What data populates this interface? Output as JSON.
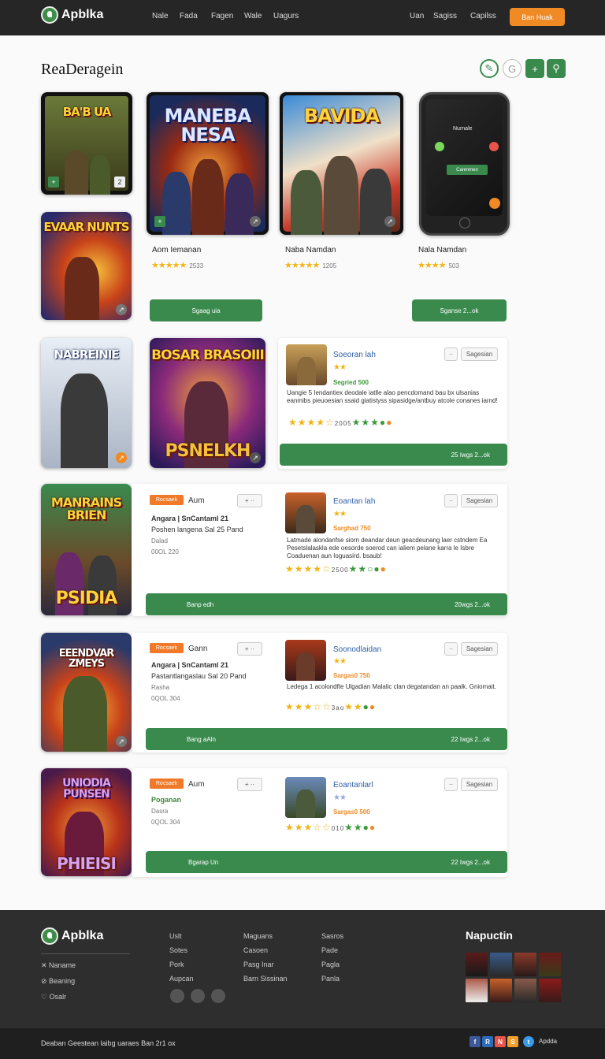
{
  "header": {
    "app_name": "Apblka",
    "nav_left": [
      "Nale",
      "Fada",
      "Fagen",
      "Wale",
      "Uagurs"
    ],
    "nav_right": [
      "Uan",
      "Sagiss",
      "Capilss"
    ],
    "cta_label": "Ban Huak"
  },
  "page": {
    "title": "ReaDeragein",
    "toolbar_icons": [
      "pencil-icon",
      "g-icon",
      "plus-icon",
      "search-icon"
    ]
  },
  "games_top": [
    {
      "title": "BA'B UA",
      "name": "",
      "rating": "",
      "count": ""
    },
    {
      "title": "MANEBA NESA",
      "name": "Aom Iemanan",
      "rating": "★★★★★",
      "count": "2533"
    },
    {
      "title": "BAVIDA",
      "name": "Naba Namdan",
      "rating": "★★★★★",
      "count": "1205"
    },
    {
      "title": "",
      "name": "Nala Namdan",
      "rating": "★★★★",
      "count": "503"
    }
  ],
  "phone": {
    "title": "Nurnale",
    "button": "Canmmen"
  },
  "top_buttons": {
    "left": "Sgaag uia",
    "right": "Sganse 2...ok"
  },
  "side_games": [
    {
      "title": "EVAAR NUNTS"
    },
    {
      "title": "NABREINIE"
    },
    {
      "title": "BOSAR BRASOIII",
      "subtitle": "PSNELKH"
    },
    {
      "title": "MANRAINS BRIEN",
      "subtitle": "PSIDIA"
    },
    {
      "title": "EEENDVAR ZMEYS"
    },
    {
      "title": "UNIODIA PUNSEN",
      "subtitle": "PHIEISI"
    }
  ],
  "listings": [
    {
      "tag": "",
      "name": "",
      "info": [],
      "review": {
        "user": "Soeoran lah",
        "tag": "Segried 500",
        "text": "Uangie 5 Iendantiex deodale iatlle alao pencdomand bau bx ulsanias eanmibs pieuoesian ssaid giatistyss sipasidge/antbuy atcole conanes iarnd!",
        "stars": "2005",
        "btn_small": "··",
        "btn_follow": "Sagesian"
      },
      "bottom_left": "",
      "bottom_right": "25 Iwgs 2...ok"
    },
    {
      "tag": "Rocsaek",
      "name": "Aum",
      "info": [
        "Angara | SnCantaml 21",
        "Poshen langena Sal 25 Pand",
        "Dalad",
        "00OL 220"
      ],
      "review": {
        "user": "Eoantan lah",
        "tag": "Sarghad 750",
        "text": "Latmade alondanfse siorn deandar deun geacdeunang laer cstndem Ea Pesetslalaskla ede oesorde soerod can ialiem pelane karra le Isbre Coaduenan aun Ioguasird. bsaub!",
        "stars": "2500",
        "btn_small": "··",
        "btn_follow": "Sagesian"
      },
      "bottom_left": "Banp edh",
      "bottom_right": "20wgs 2...ok"
    },
    {
      "tag": "Rocsaek",
      "name": "Gann",
      "info": [
        "Angara | SnCantaml 21",
        "Pastantlangaslau Sal 20 Pand",
        "Rasha",
        "0QOL 304"
      ],
      "review": {
        "user": "Soonodlaidan",
        "tag": "Sargas0 750",
        "text": "Ledega 1 acolondfte Ulgadian Malalic clan degatandan an paalk. Gniomait.",
        "stars": "3ao",
        "btn_small": "··",
        "btn_follow": "Sagesian"
      },
      "bottom_left": "Bang aAln",
      "bottom_right": "22 Iwgs 2...ok"
    },
    {
      "tag": "Rocsaek",
      "name": "Aum",
      "info": [
        "Poganan",
        "Dasra",
        "0QOL 304"
      ],
      "review": {
        "user": "Eoantanlarl",
        "tag": "Sargas0 500",
        "text": "",
        "stars": "010",
        "btn_small": "··",
        "btn_follow": "Sagesian"
      },
      "bottom_left": "Bgarap Un",
      "bottom_right": "22 Iwgs 2...ok"
    }
  ],
  "footer": {
    "app_name": "Apblka",
    "links_left": [
      "Naname",
      "Beaning",
      "Osalr"
    ],
    "col1": [
      "Uslt",
      "Sotes",
      "Pork",
      "Aupcan"
    ],
    "col2": [
      "Maguans",
      "Casoen",
      "Pasg Inar",
      "Barn Sissinan"
    ],
    "col3": [
      "Sasros",
      "Pade",
      "Pagla",
      "Panla"
    ],
    "gallery_title": "Napuctin",
    "copyright": "Deaban Geestean laibg uaraes Ban 2r1 ox",
    "social_label": "Apdda"
  },
  "colors": {
    "accent_green": "#3a8a4e",
    "accent_orange": "#f08a24",
    "header_bg": "#262626",
    "star": "#f3b315"
  }
}
